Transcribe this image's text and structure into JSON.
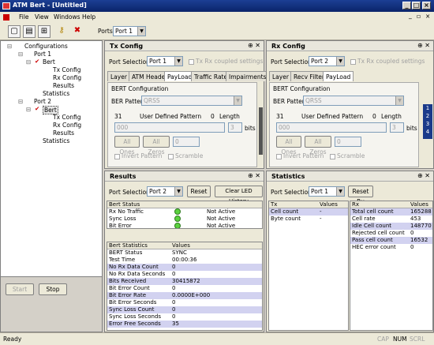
{
  "app": {
    "title": "ATM Bert - [Untitled]"
  },
  "menu": {
    "file": "File",
    "view": "View",
    "windows": "Windows",
    "help": "Help"
  },
  "toolbar": {
    "ports_label": "Ports:",
    "ports_value": "Port 1"
  },
  "tree": {
    "root": "Configurations",
    "port1": "Port 1",
    "bert1": "Bert",
    "tx1": "Tx Config",
    "rx1": "Rx Config",
    "results1": "Results",
    "stats1": "Statistics",
    "port2": "Port 2",
    "bert2": "Bert",
    "tx2": "Tx Config",
    "rx2": "Rx Config",
    "results2": "Results",
    "stats2": "Statistics"
  },
  "left_buttons": {
    "start": "Start",
    "stop": "Stop"
  },
  "tx": {
    "title": "Tx Config",
    "port_label": "Port Selection",
    "port_value": "Port 1",
    "coupled": "Tx Rx coupled settings",
    "tabs": [
      "Layer",
      "ATM Header",
      "PayLoad",
      "Traffic Rate",
      "Impairments"
    ],
    "group": "BERT Configuration",
    "ber_label": "BER Pattern",
    "ber_value": "QRSS",
    "num31": "31",
    "udp_label": "User Defined Pattern",
    "zero": "0",
    "length_label": "Length",
    "pattern_value": "000",
    "length_value": "3",
    "bits": "bits",
    "all_ones": "All Ones",
    "all_zeros": "All Zeros",
    "zero_field": "0",
    "invert": "Invert Pattern",
    "scramble": "Scramble"
  },
  "rx": {
    "title": "Rx Config",
    "port_label": "Port Selection",
    "port_value": "Port 2",
    "coupled": "Tx Rx coupled settings",
    "tabs": [
      "Layer",
      "Recv Filter",
      "PayLoad"
    ],
    "group": "BERT Configuration",
    "ber_label": "BER Pattern",
    "ber_value": "QRSS",
    "num31": "31",
    "udp_label": "User Defined Pattern",
    "zero": "0",
    "length_label": "Length",
    "pattern_value": "000",
    "length_value": "3",
    "bits": "bits",
    "all_ones": "All Ones",
    "all_zeros": "All Zeros",
    "zero_field": "0",
    "invert": "Invert Pattern",
    "scramble": "Scramble",
    "side_nums": [
      "1",
      "2",
      "3",
      "4"
    ]
  },
  "results": {
    "title": "Results",
    "port_label": "Port Selection",
    "port_value": "Port 2",
    "reset": "Reset",
    "clear": "Clear LED History",
    "status_header": "Bert Status",
    "status_rows": [
      {
        "name": "Rx No Traffic",
        "state": "Not Active"
      },
      {
        "name": "Sync Loss",
        "state": "Not Active"
      },
      {
        "name": "Bit Error",
        "state": "Not Active"
      }
    ],
    "stats_header": "Bert Statistics",
    "values_header": "Values",
    "stats_rows": [
      {
        "name": "BERT Status",
        "value": "SYNC"
      },
      {
        "name": "Test Time",
        "value": "00:00:36"
      },
      {
        "name": "No Rx Data Count",
        "value": "0"
      },
      {
        "name": "No Rx Data Seconds",
        "value": "0"
      },
      {
        "name": "Bits Received",
        "value": "30415872"
      },
      {
        "name": "Bit Error Count",
        "value": "0"
      },
      {
        "name": "Bit Error Rate",
        "value": "0.0000E+000"
      },
      {
        "name": "Bit Error Seconds",
        "value": "0"
      },
      {
        "name": "Sync Loss Count",
        "value": "0"
      },
      {
        "name": "Sync Loss Seconds",
        "value": "0"
      },
      {
        "name": "Error Free Seconds",
        "value": "35"
      }
    ]
  },
  "statistics": {
    "title": "Statistics",
    "port_label": "Port Selection",
    "port_value": "Port 1",
    "reset": "Reset Rx",
    "tx_header": "Tx",
    "tx_values_header": "Values",
    "rx_header": "Rx",
    "rx_values_header": "Values",
    "tx_rows": [
      {
        "name": "Cell count",
        "value": "-"
      },
      {
        "name": "Byte count",
        "value": "-"
      }
    ],
    "rx_rows": [
      {
        "name": "Total cell count",
        "value": "165288"
      },
      {
        "name": "Cell rate",
        "value": "453"
      },
      {
        "name": "Idle Cell count",
        "value": "148770"
      },
      {
        "name": "Rejected cell count",
        "value": "0"
      },
      {
        "name": "Pass cell count",
        "value": "16532"
      },
      {
        "name": "HEC error count",
        "value": "0"
      }
    ]
  },
  "status": {
    "ready": "Ready",
    "cap": "CAP",
    "num": "NUM",
    "scrl": "SCRL"
  }
}
